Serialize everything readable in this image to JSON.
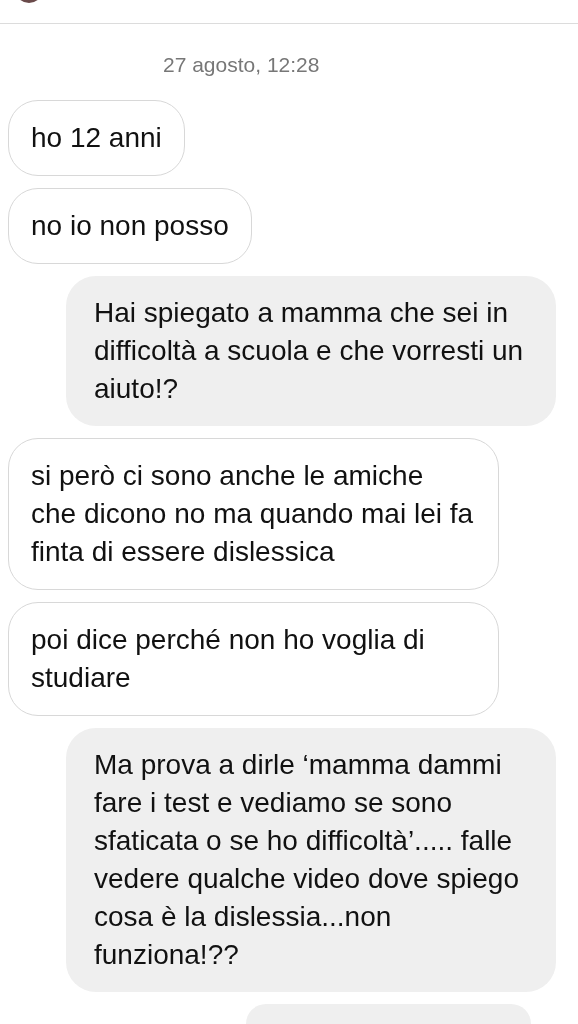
{
  "timestamp": "27 agosto, 12:28",
  "messages": [
    {
      "kind": "incoming",
      "text": "ho 12 anni"
    },
    {
      "kind": "incoming",
      "text": "no io non posso"
    },
    {
      "kind": "outgoing",
      "text": "Hai spiegato a mamma che sei in difficoltà a scuola e che vorresti un aiuto!?"
    },
    {
      "kind": "incoming",
      "text": "si però ci sono anche le amiche che dicono no ma quando mai lei fa finta di essere dislessica"
    },
    {
      "kind": "incoming",
      "text": "poi dice perché non ho voglia di studiare"
    },
    {
      "kind": "outgoing",
      "text": "Ma prova a dirle ‘mamma dammi fare i test e vediamo se sono sfaticata o se ho difficoltà’..... falle vedere qualche video dove spiego cosa è la dislessia...non funziona!??"
    }
  ]
}
